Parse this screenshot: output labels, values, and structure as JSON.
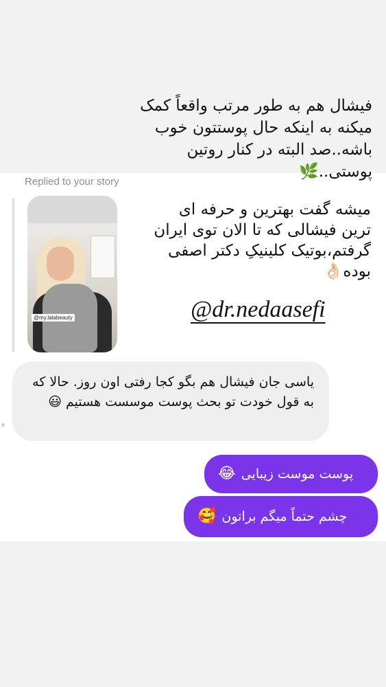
{
  "caption_top": "فیشال هم به طور مرتب واقعاً کمک میکنه به اینکه حال پوستتون خوب باشه..صد البته در کنار روتین پوستی..🌿",
  "replied_label": "Replied to your story",
  "story": {
    "tag": "@my.lalabeauty"
  },
  "caption_mid": "میشه گفت بهترین و حرفه ای ترین فیشالی که تا الان توی ایران گرفتم،بوتیک کلینیکِ دکتر اصفی بوده👌🏻",
  "mention": "@dr.nedaasefi",
  "received_message": "یاسی جان فیشال هم بگو کجا رفتی اون روز. حالا که به قول خودت تو بحث پوست موسست هستیم 😃",
  "sent_messages": [
    {
      "text": "پوست موست زیبایی",
      "emoji": "😂"
    },
    {
      "text": "چشم حتماً میگم براتون",
      "emoji": "🥰"
    }
  ],
  "colors": {
    "sent_bubble": "#7a35ea",
    "received_bubble": "#efefef",
    "caption_bg": "#f2f2f2"
  }
}
